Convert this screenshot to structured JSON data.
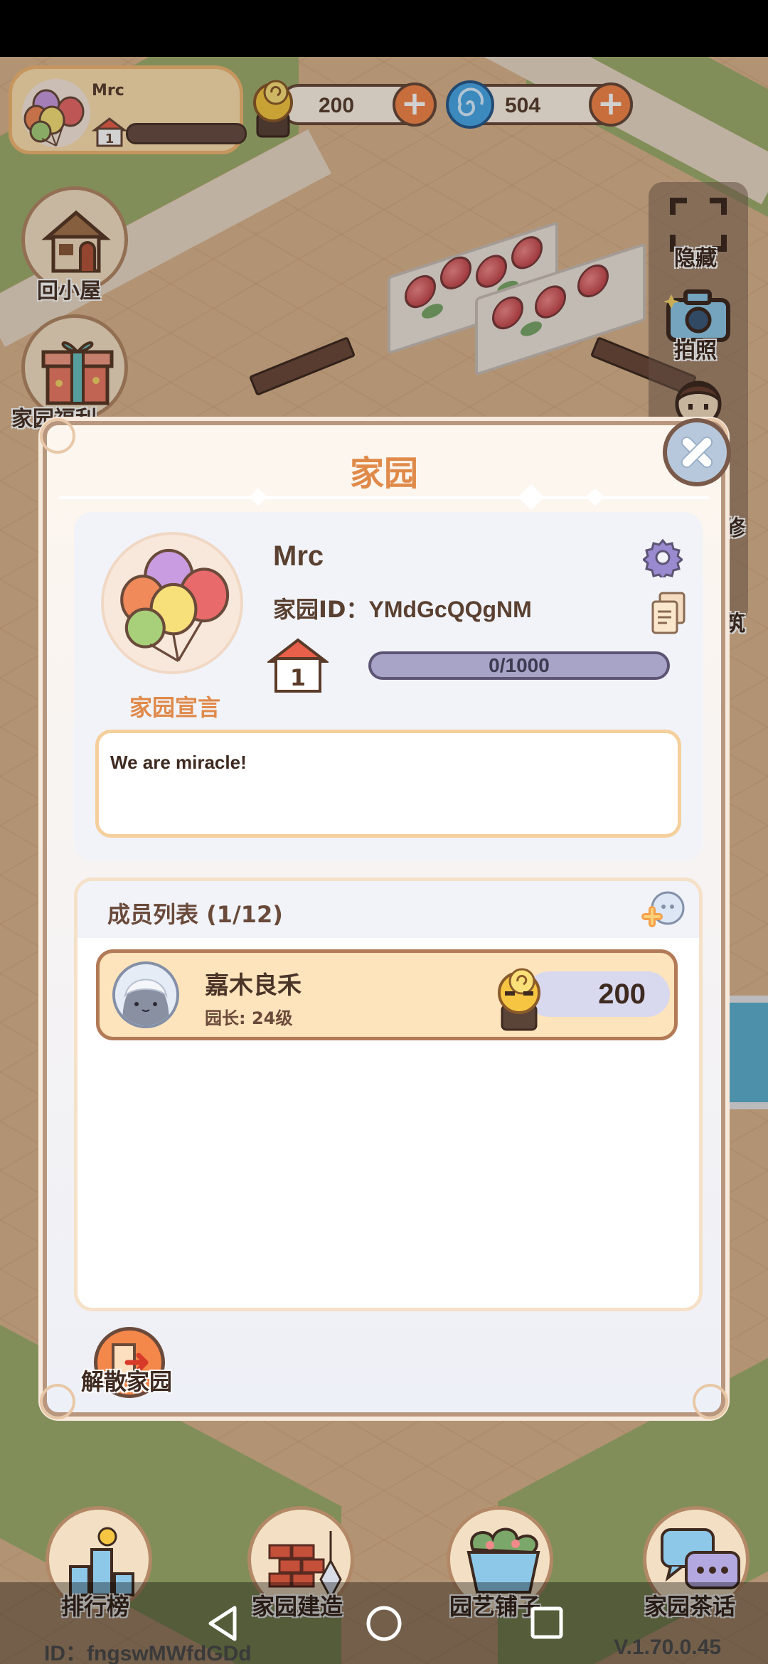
{
  "top": {
    "player_name": "Mrc",
    "home_level": "1",
    "snail_coins": "200",
    "blue_currency": "504"
  },
  "left_buttons": [
    {
      "label": "回小屋"
    },
    {
      "label": "家园福利"
    }
  ],
  "right_buttons": [
    {
      "label": "隐藏"
    },
    {
      "label": "拍照"
    },
    {
      "label": "修"
    },
    {
      "label": "筑"
    }
  ],
  "modal": {
    "title": "家园",
    "home_name": "Mrc",
    "home_id_label": "家园ID：",
    "home_id_value": "YMdGcQQgNM",
    "level": "1",
    "exp_text": "0/1000",
    "declaration_label": "家园宣言",
    "declaration_text": "We are miracle!",
    "members_title": "成员列表 (1/12)",
    "members": [
      {
        "name": "嘉木良禾",
        "role": "园长: 24级",
        "score": "200"
      }
    ],
    "disband_label": "解散家园"
  },
  "bottom_nav": [
    {
      "label": "排行榜"
    },
    {
      "label": "家园建造"
    },
    {
      "label": "园艺铺子"
    },
    {
      "label": "家园茶话"
    }
  ],
  "footer": {
    "id_text": "ID：fngswMWfdGDd",
    "version": "V.1.70.0.45"
  },
  "colors": {
    "accent_orange": "#e08a4a",
    "plus_button": "#f4874a",
    "modal_border": "#b8977e",
    "member_row_bg": "#fde4bc"
  }
}
